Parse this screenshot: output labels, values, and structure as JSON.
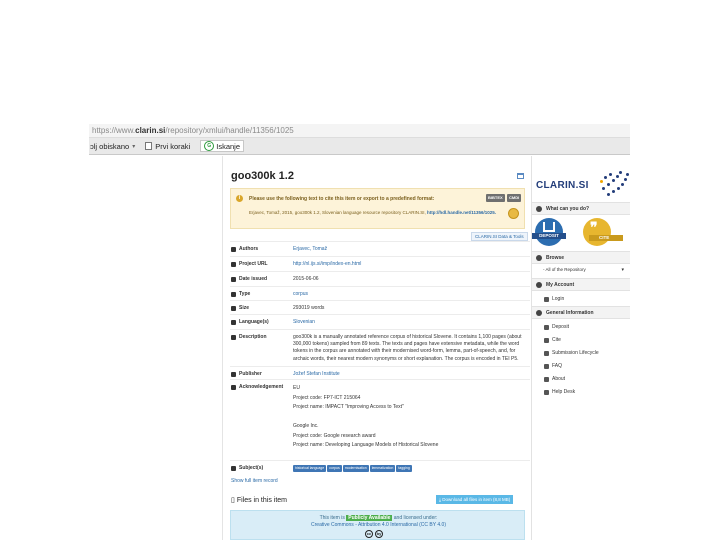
{
  "browser": {
    "url_prefix": "https://www.",
    "url_domain": "clarin.si",
    "url_path": "/repository/xmlui/handle/11356/1025",
    "bookmarks": [
      {
        "label": "ɔlj obiskano"
      },
      {
        "label": "Prvi koraki"
      }
    ],
    "search_label": "Iskanje"
  },
  "item": {
    "title": "goo300k 1.2",
    "cite_message": "Please use the following text to cite this item or export to a predefined format:",
    "cite_formats": [
      "BIBTEX",
      "CMDI"
    ],
    "cite_text": "Erjavec, Tomaž, 2015, goo300k 1.2, Slovenian language resource repository CLARIN.SI, ",
    "cite_link": "http://hdl.handle.net/11356/1025.",
    "tools_button": "CLARIN.SI Data & Tools"
  },
  "fields": {
    "authors": {
      "label": "Authors",
      "value": "Erjavec, Tomaž"
    },
    "project_url": {
      "label": "Project URL",
      "value": "http://nl.ijs.si/imp/index-en.html"
    },
    "date_issued": {
      "label": "Date issued",
      "value": "2015-06-06"
    },
    "type": {
      "label": "Type",
      "value": "corpus"
    },
    "size": {
      "label": "Size",
      "value": "293019 words"
    },
    "language": {
      "label": "Language(s)",
      "value": "Slovenian"
    },
    "description": {
      "label": "Description",
      "value": "goo300k is a manually annotated reference corpus of historical Slovene. It contains 1,100 pages (about 300,000 tokens) sampled from 89 texts. The texts and pages have extensive metadata, while the word tokens in the corpus are annotated with their modernised word-form, lemma, part-of-speech, and, for archaic words, their nearest modern synonyms or short explanation. The corpus is encoded in TEI P5."
    },
    "publisher": {
      "label": "Publisher",
      "value": "Jožef Stefan Institute"
    },
    "acknowledgement": {
      "label": "Acknowledgement",
      "lines": [
        "EU",
        "Project code: FP7-ICT 215064",
        "Project name: IMPACT \"Improving Access to Text\"",
        "",
        "Google Inc.",
        "Project code: Google research award",
        "Project name: Developing Language Models of Historical Slovene"
      ]
    },
    "subjects": {
      "label": "Subject(s)",
      "tags": [
        "historical language",
        "corpus",
        "modernisation",
        "lemmatization",
        "tagging"
      ]
    }
  },
  "show_full": "Show full item record",
  "files": {
    "title": "Files in this item",
    "download_button": "Download all files in item (8,8 MB)",
    "license_pre": "This item is",
    "license_avail": "Publicly Available",
    "license_post": "and licensed under:",
    "license_name": "Creative Commons - Attribution 4.0 International (CC BY 4.0)",
    "cc_icons": [
      "cc",
      "by"
    ]
  },
  "sidebar": {
    "logo": "CLARIN.SI",
    "what_label": "What can you do?",
    "deposit_label": "DEPOSIT",
    "cite_label": "CITE",
    "browse_label": "Browse",
    "browse_select": "- All of the Repository",
    "account_label": "My Account",
    "login_label": "Login",
    "general_label": "General Information",
    "general_items": [
      "Deposit",
      "Cite",
      "Submission Lifecycle",
      "FAQ",
      "About",
      "Help Desk"
    ]
  }
}
